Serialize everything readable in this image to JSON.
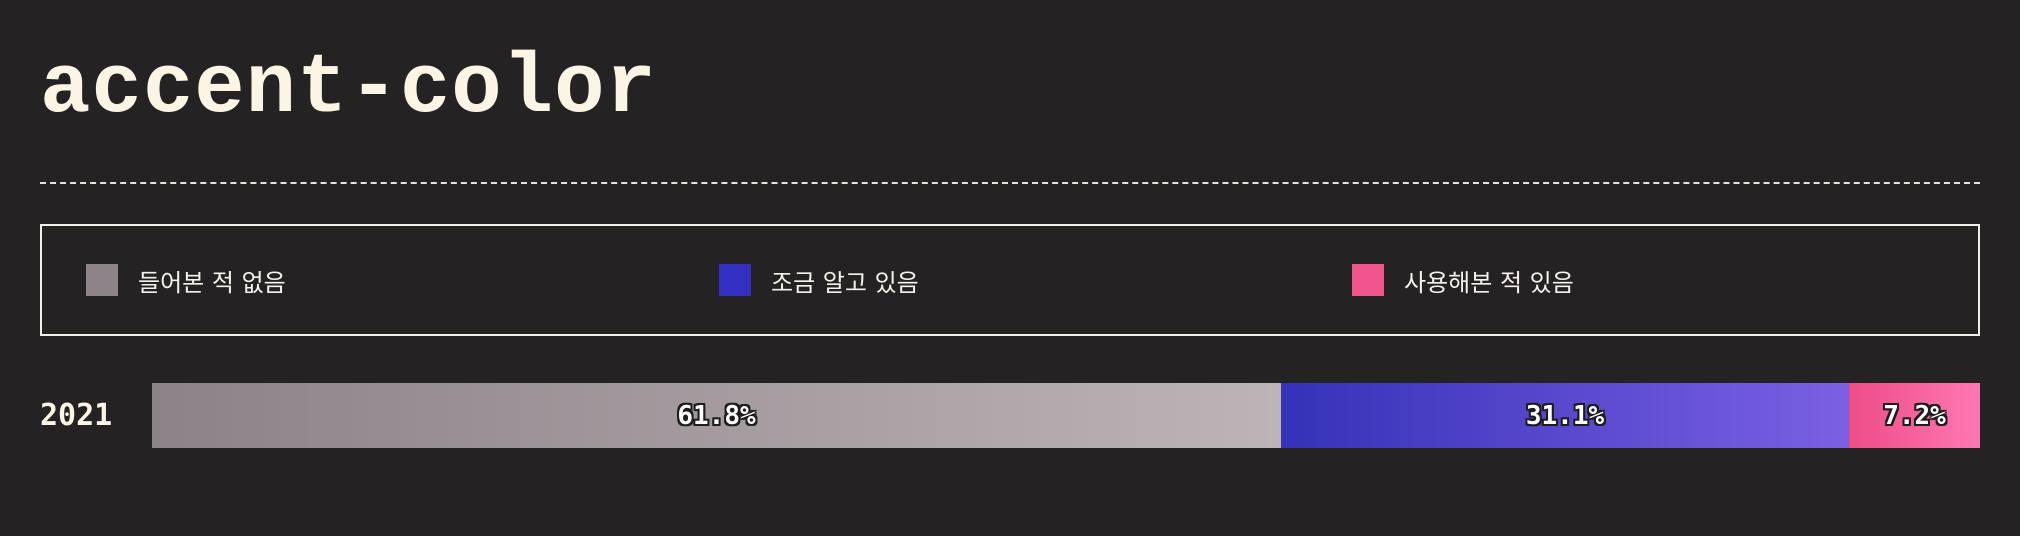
{
  "title": "accent-color",
  "legend": [
    {
      "label": "들어본 적 없음",
      "color": "#8d8389"
    },
    {
      "label": "조금 알고 있음",
      "color": "#3430c2"
    },
    {
      "label": "사용해본 적 있음",
      "color": "#f2548d"
    }
  ],
  "chart_data": {
    "type": "bar",
    "orientation": "horizontal",
    "stacked": true,
    "categories": [
      "2021"
    ],
    "series": [
      {
        "name": "들어본 적 없음",
        "values": [
          61.8
        ],
        "labels": [
          "61.8%"
        ],
        "gradient": [
          "#8c8288",
          "#bcb4b7"
        ]
      },
      {
        "name": "조금 알고 있음",
        "values": [
          31.1
        ],
        "labels": [
          "31.1%"
        ],
        "gradient": [
          "#3532b8",
          "#7b60e3"
        ]
      },
      {
        "name": "사용해본 적 있음",
        "values": [
          7.2
        ],
        "labels": [
          "7.2%"
        ],
        "gradient": [
          "#ed4d87",
          "#ff77b2"
        ]
      }
    ],
    "xlim": [
      0,
      100
    ],
    "legend_position": "top",
    "grid": false
  }
}
